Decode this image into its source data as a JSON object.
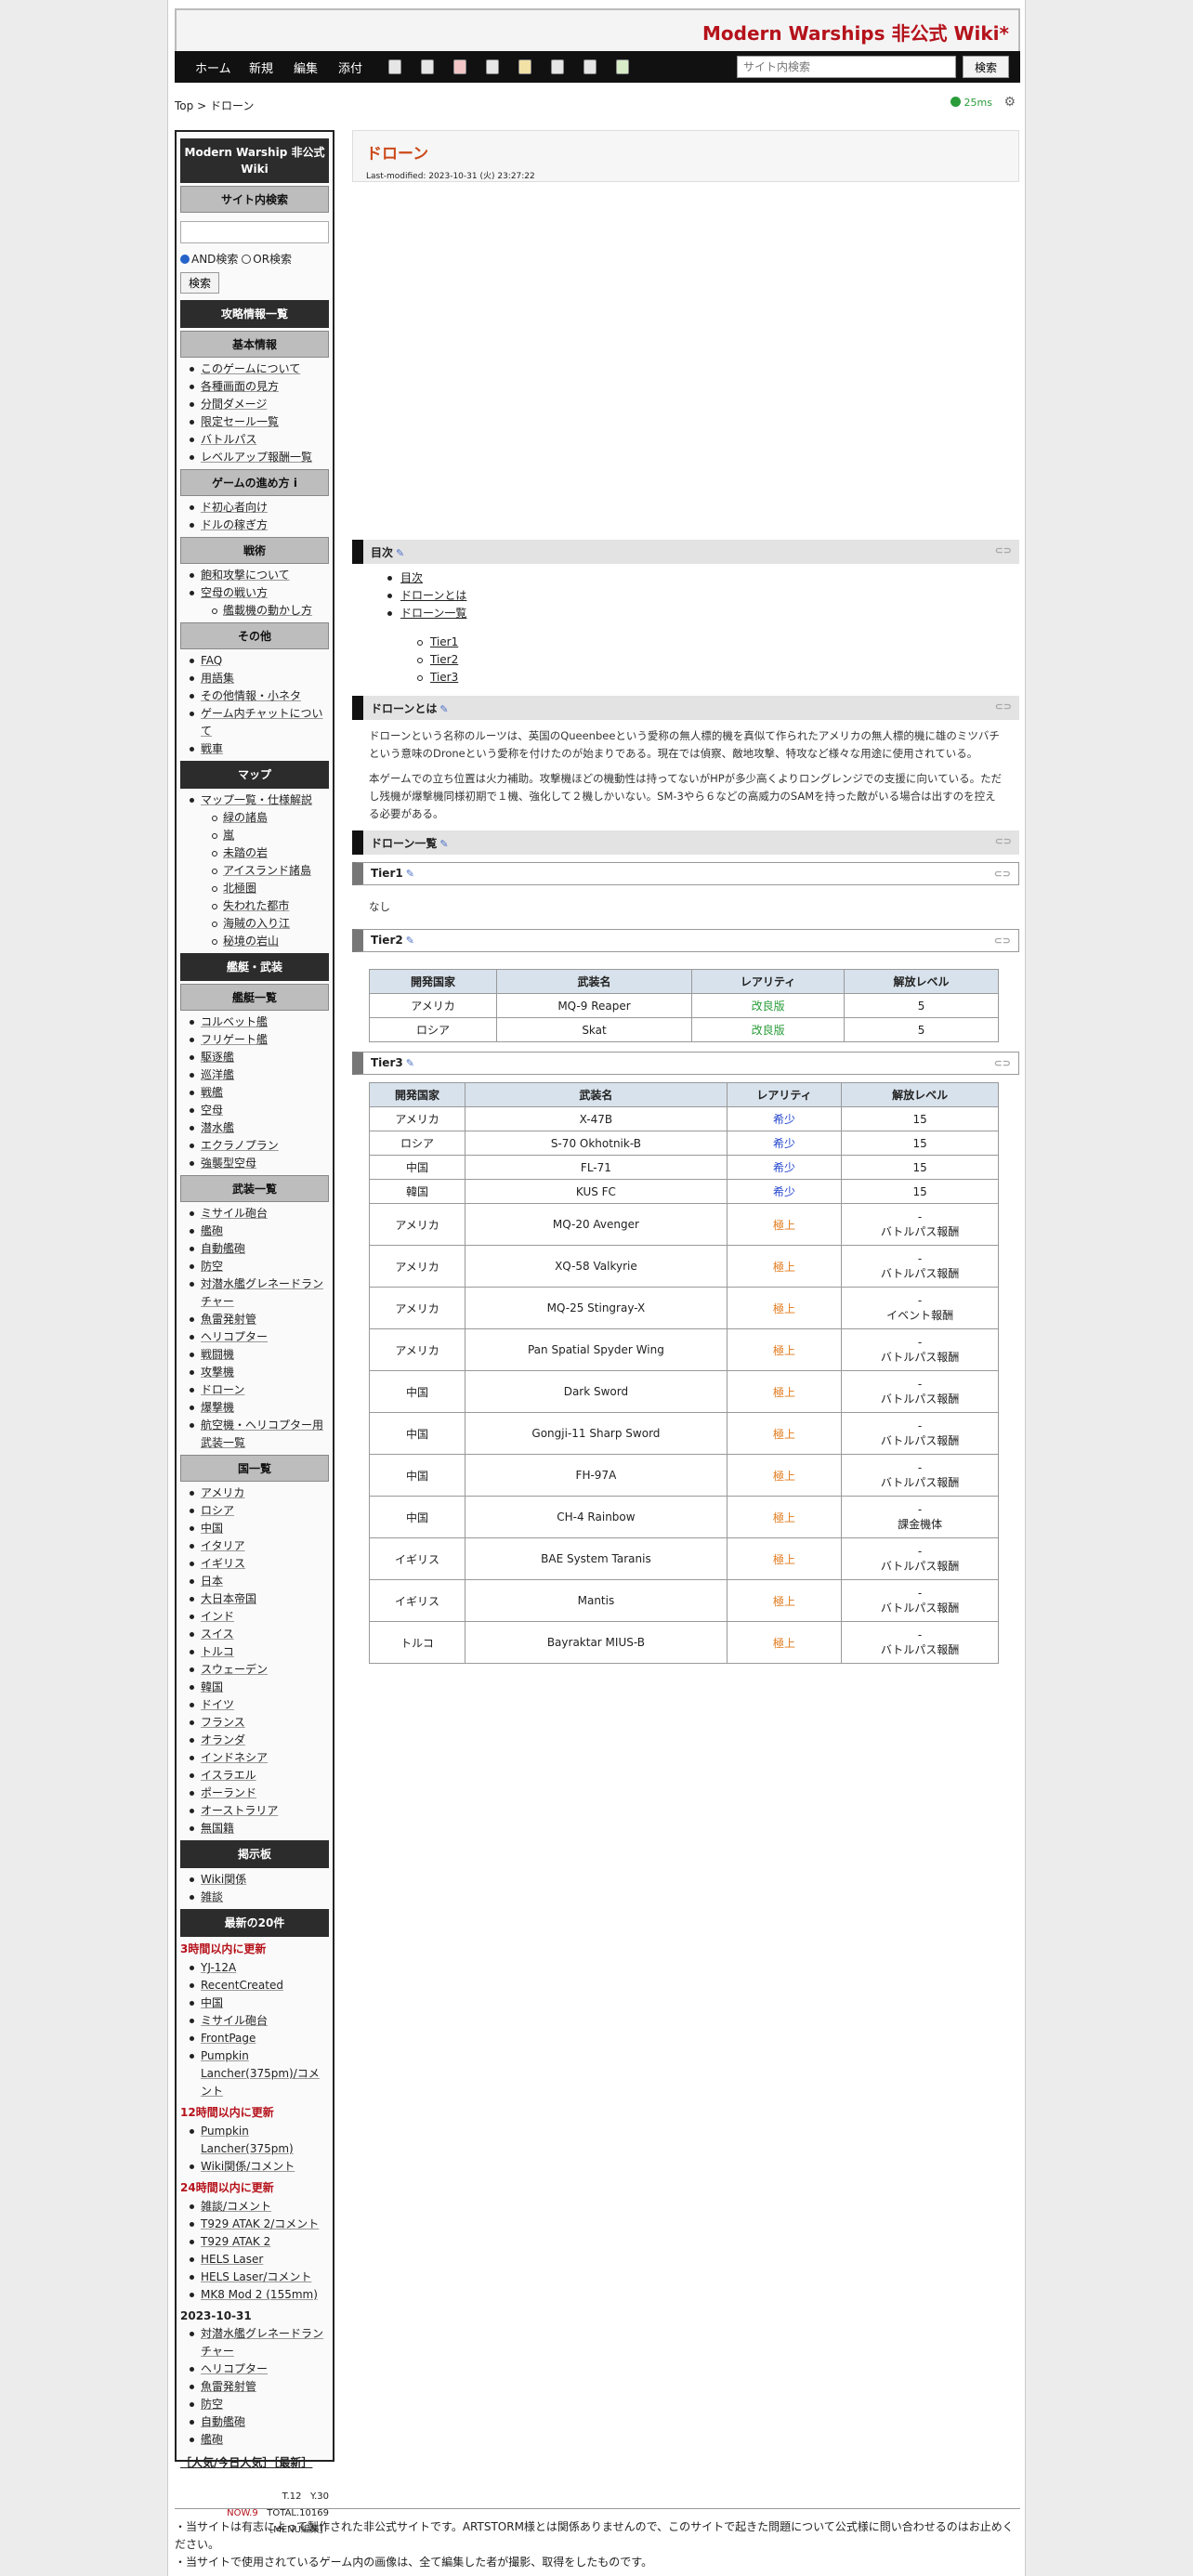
{
  "site": {
    "title": "Modern Warships 非公式 Wiki*"
  },
  "topnav": {
    "links": [
      "ホーム",
      "新規",
      "編集",
      "添付"
    ],
    "search_placeholder": "サイト内検索",
    "search_button": "検索"
  },
  "breadcrumb": {
    "root": "Top",
    "sep": " > ",
    "current": "ドローン"
  },
  "perf": "25ms",
  "sidebar": {
    "header": "Modern Warship 非公式 Wiki",
    "search_title": "サイト内検索",
    "and_label": "AND検索",
    "or_label": "OR検索",
    "search_button": "検索",
    "strategy_title": "攻略情報一覧",
    "basic_title": "基本情報",
    "basic_items": [
      "このゲームについて",
      "各種画面の見方",
      "分間ダメージ",
      "限定セール一覧",
      "バトルパス",
      "レベルアップ報酬一覧"
    ],
    "progress_title": "ゲームの進め方 i",
    "progress_items": [
      "ド初心者向け",
      "ドルの稼ぎ方"
    ],
    "tactics_title": "戦術",
    "tactics_items": [
      "飽和攻撃について",
      "空母の戦い方"
    ],
    "tactics_sub": [
      "艦載機の動かし方"
    ],
    "other_title": "その他",
    "other_items": [
      "FAQ",
      "用語集",
      "その他情報・小ネタ",
      "ゲーム内チャットについて",
      "戦車"
    ],
    "map_title": "マップ",
    "map_items": [
      "マップ一覧・仕様解説"
    ],
    "map_sub": [
      "緑の諸島",
      "嵐",
      "未踏の岩",
      "アイスランド諸島",
      "北極圏",
      "失われた都市",
      "海賊の入り江",
      "秘境の岩山"
    ],
    "ships_title": "艦艇・武装",
    "shiplist_title": "艦艇一覧",
    "ship_items": [
      "コルベット艦",
      "フリゲート艦",
      "駆逐艦",
      "巡洋艦",
      "戦艦",
      "空母",
      "潜水艦",
      "エクラノプラン",
      "強襲型空母"
    ],
    "weapons_title": "武装一覧",
    "weapon_items": [
      "ミサイル砲台",
      "艦砲",
      "自動艦砲",
      "防空",
      "対潜水艦グレネードランチャー",
      "魚雷発射管",
      "ヘリコプター",
      "戦闘機",
      "攻撃機",
      "ドローン",
      "爆撃機",
      "航空機・ヘリコプター用武装一覧"
    ],
    "countries_title": "国一覧",
    "country_items": [
      "アメリカ",
      "ロシア",
      "中国",
      "イタリア",
      "イギリス",
      "日本",
      "大日本帝国",
      "インド",
      "スイス",
      "トルコ",
      "スウェーデン",
      "韓国",
      "ドイツ",
      "フランス",
      "オランダ",
      "インドネシア",
      "イスラエル",
      "ポーランド",
      "オーストラリア",
      "無国籍"
    ],
    "board_title": "掲示板",
    "board_items": [
      "Wiki関係",
      "雑談"
    ],
    "recent_title": "最新の20件",
    "g1_label": "3時間以内に更新",
    "g1_items": [
      "YJ-12A",
      "RecentCreated",
      "中国",
      "ミサイル砲台",
      "FrontPage",
      "Pumpkin Lancher(375pm)/コメント"
    ],
    "g2_label": "12時間以内に更新",
    "g2_items": [
      "Pumpkin Lancher(375pm)",
      "Wiki関係/コメント"
    ],
    "g3_label": "24時間以内に更新",
    "g3_items": [
      "雑談/コメント",
      "T929 ATAK 2/コメント",
      "T929 ATAK 2",
      "HELS Laser",
      "HELS Laser/コメント",
      "MK8 Mod 2 (155mm)"
    ],
    "date_label": "2023-10-31",
    "date_items": [
      "対潜水艦グレネードランチャー",
      "ヘリコプター",
      "魚雷発射管",
      "防空",
      "自動艦砲",
      "艦砲"
    ],
    "popular": "［人気/今日人気］［最新］",
    "counter_t": "T.12",
    "counter_y": "Y.30",
    "counter_now": "NOW.9",
    "counter_total": "TOTAL.10169",
    "menu_edit": "［MENU編集］"
  },
  "main": {
    "title": "ドローン",
    "last_modified": "Last-modified: 2023-10-31 (火) 23:27:22",
    "toc_heading": "目次",
    "toc": [
      "目次",
      "ドローンとは",
      "ドローン一覧"
    ],
    "toc_sub": [
      "Tier1",
      "Tier2",
      "Tier3"
    ],
    "about_heading": "ドローンとは",
    "about_p1": "ドローンという名称のルーツは、英国のQueenbeeという愛称の無人標的機を真似て作られたアメリカの無人標的機に雄のミツバチという意味のDroneという愛称を付けたのが始まりである。現在では偵察、敵地攻撃、特攻など様々な用途に使用されている。",
    "about_p2": "本ゲームでの立ち位置は火力補助。攻撃機ほどの機動性は持ってないがHPが多少高くよりロングレンジでの支援に向いている。ただし残機が爆撃機同様初期で１機、強化して２機しかいない。SM-3やら６などの高威力のSAMを持った敵がいる場合は出すのを控える必要がある。",
    "list_heading": "ドローン一覧",
    "tier1_heading": "Tier1",
    "tier1_text": "なし",
    "tier2_heading": "Tier2",
    "tier3_heading": "Tier3",
    "columns": [
      "開発国家",
      "武装名",
      "レアリティ",
      "解放レベル"
    ],
    "tier2_rows": [
      {
        "country": "アメリカ",
        "name": "MQ-9 Reaper",
        "rarity": "改良版",
        "level": "5"
      },
      {
        "country": "ロシア",
        "name": "Skat",
        "rarity": "改良版",
        "level": "5"
      }
    ],
    "tier3_rows": [
      {
        "country": "アメリカ",
        "name": "X-47B",
        "rarity": "希少",
        "level": "15"
      },
      {
        "country": "ロシア",
        "name": "S-70 Okhotnik-B",
        "rarity": "希少",
        "level": "15"
      },
      {
        "country": "中国",
        "name": "FL-71",
        "rarity": "希少",
        "level": "15"
      },
      {
        "country": "韓国",
        "name": "KUS FC",
        "rarity": "希少",
        "level": "15"
      }
    ],
    "tier3_rows_tall": [
      {
        "country": "アメリカ",
        "name": "MQ-20 Avenger",
        "rarity": "極上",
        "level_top": "-",
        "level_bottom": "バトルパス報酬"
      },
      {
        "country": "アメリカ",
        "name": "XQ-58 Valkyrie",
        "rarity": "極上",
        "level_top": "-",
        "level_bottom": "バトルパス報酬"
      },
      {
        "country": "アメリカ",
        "name": "MQ-25 Stingray-X",
        "rarity": "極上",
        "level_top": "-",
        "level_bottom": "イベント報酬"
      },
      {
        "country": "アメリカ",
        "name": "Pan Spatial Spyder Wing",
        "rarity": "極上",
        "level_top": "-",
        "level_bottom": "バトルパス報酬"
      },
      {
        "country": "中国",
        "name": "Dark Sword",
        "rarity": "極上",
        "level_top": "-",
        "level_bottom": "バトルパス報酬"
      },
      {
        "country": "中国",
        "name": "Gongji-11 Sharp Sword",
        "rarity": "極上",
        "level_top": "-",
        "level_bottom": "バトルパス報酬"
      },
      {
        "country": "中国",
        "name": "FH-97A",
        "rarity": "極上",
        "level_top": "-",
        "level_bottom": "バトルパス報酬"
      },
      {
        "country": "中国",
        "name": "CH-4 Rainbow",
        "rarity": "極上",
        "level_top": "-",
        "level_bottom": "課金機体"
      },
      {
        "country": "イギリス",
        "name": "BAE System Taranis",
        "rarity": "極上",
        "level_top": "-",
        "level_bottom": "バトルパス報酬"
      },
      {
        "country": "イギリス",
        "name": "Mantis",
        "rarity": "極上",
        "level_top": "-",
        "level_bottom": "バトルパス報酬"
      },
      {
        "country": "トルコ",
        "name": "Bayraktar MIUS-B",
        "rarity": "極上",
        "level_top": "-",
        "level_bottom": "バトルパス報酬"
      }
    ]
  },
  "footer": {
    "line1": "・当サイトは有志によって製作された非公式サイトです。ARTSTORM様とは関係ありませんので、このサイトで起きた問題について公式様に問い合わせるのはお止めください。",
    "line2": "・当サイトで使用されているゲーム内の画像は、全て編集した者が撮影、取得をしたものです。"
  },
  "colors": {
    "brand": "#b5121b",
    "title": "#cc4a1a",
    "improved": "#2a9c3a",
    "rare": "#2244cc",
    "epic": "#e07818"
  }
}
